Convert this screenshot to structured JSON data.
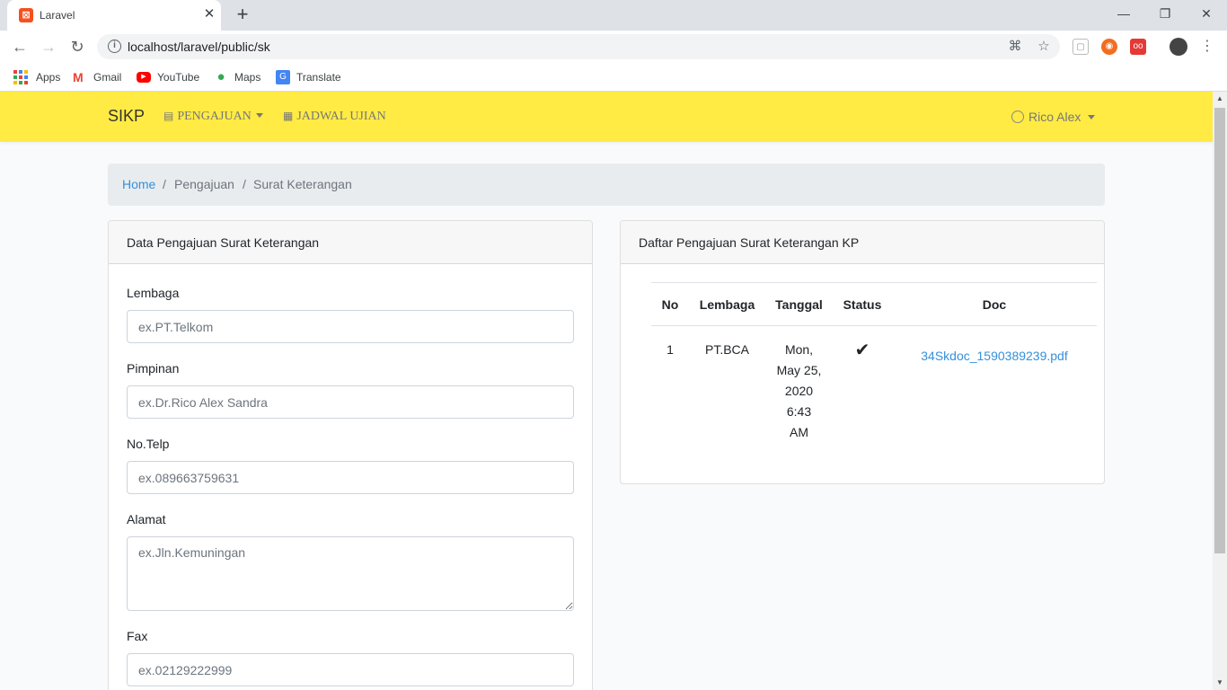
{
  "browser": {
    "tab_title": "Laravel",
    "url": "localhost/laravel/public/sk",
    "bookmarks": [
      {
        "label": "Apps",
        "icon": "apps-grid-icon"
      },
      {
        "label": "Gmail",
        "icon": "gmail-icon"
      },
      {
        "label": "YouTube",
        "icon": "youtube-icon"
      },
      {
        "label": "Maps",
        "icon": "maps-icon"
      },
      {
        "label": "Translate",
        "icon": "translate-icon"
      }
    ]
  },
  "navbar": {
    "brand": "SIKP",
    "links": [
      {
        "label": "PENGAJUAN",
        "icon": "id-card-icon",
        "dropdown": true
      },
      {
        "label": "JADWAL UJIAN",
        "icon": "calendar-icon",
        "dropdown": false
      }
    ],
    "user": "Rico Alex"
  },
  "breadcrumb": {
    "items": [
      "Home",
      "Pengajuan",
      "Surat Keterangan"
    ]
  },
  "form_card": {
    "title": "Data Pengajuan Surat Keterangan",
    "fields": [
      {
        "label": "Lembaga",
        "placeholder": "ex.PT.Telkom"
      },
      {
        "label": "Pimpinan",
        "placeholder": "ex.Dr.Rico Alex Sandra"
      },
      {
        "label": "No.Telp",
        "placeholder": "ex.089663759631"
      },
      {
        "label": "Alamat",
        "placeholder": "ex.Jln.Kemuningan"
      },
      {
        "label": "Fax",
        "placeholder": "ex.02129222999"
      }
    ]
  },
  "list_card": {
    "title": "Daftar Pengajuan Surat Keterangan KP",
    "columns": [
      "No",
      "Lembaga",
      "Tanggal",
      "Status",
      "Doc"
    ],
    "rows": [
      {
        "no": "1",
        "lembaga": "PT.BCA",
        "tanggal": [
          "Mon,",
          "May 25,",
          "2020",
          "6:43",
          "AM"
        ],
        "status": "approved-check-icon",
        "doc": "34Skdoc_1590389239.pdf"
      }
    ]
  },
  "colors": {
    "navbar": "#ffeb44",
    "link": "#3490dc",
    "page_bg": "#f8fafc"
  }
}
